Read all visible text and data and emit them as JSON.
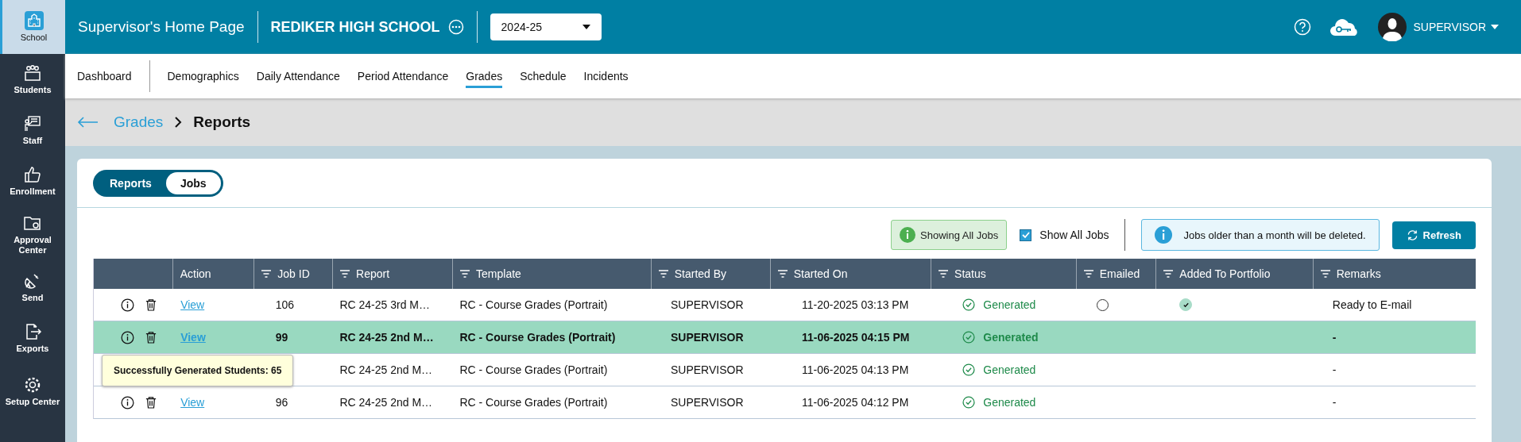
{
  "sidebar": {
    "items": [
      {
        "label": "School",
        "selected": true
      },
      {
        "label": "Students",
        "selected": false
      },
      {
        "label": "Staff",
        "selected": false
      },
      {
        "label": "Enrollment",
        "selected": false
      },
      {
        "label": "Approval Center",
        "selected": false
      },
      {
        "label": "Send",
        "selected": false
      },
      {
        "label": "Exports",
        "selected": false
      },
      {
        "label": "Setup Center",
        "selected": false
      }
    ]
  },
  "header": {
    "title": "Supervisor's Home Page",
    "school": "REDIKER HIGH SCHOOL",
    "year": "2024-25",
    "user": "SUPERVISOR"
  },
  "nav": {
    "items": [
      {
        "label": "Dashboard",
        "selected": false
      },
      {
        "label": "Demographics",
        "selected": false
      },
      {
        "label": "Daily Attendance",
        "selected": false
      },
      {
        "label": "Period Attendance",
        "selected": false
      },
      {
        "label": "Grades",
        "selected": true
      },
      {
        "label": "Schedule",
        "selected": false
      },
      {
        "label": "Incidents",
        "selected": false
      }
    ]
  },
  "breadcrumb": {
    "parent": "Grades",
    "current": "Reports"
  },
  "tabs": [
    {
      "label": "Reports",
      "selected": false
    },
    {
      "label": "Jobs",
      "selected": true
    }
  ],
  "toolbar": {
    "badge": "Showing All Jobs",
    "show_all": {
      "label": "Show All Jobs",
      "checked": true
    },
    "notice": "Jobs older than a month will be deleted.",
    "refresh": "Refresh"
  },
  "table": {
    "columns": [
      "Action",
      "Job ID",
      "Report",
      "Template",
      "Started By",
      "Started On",
      "Status",
      "Emailed",
      "Added To Portfolio",
      "Remarks"
    ],
    "rows": [
      {
        "selected": false,
        "action": "View",
        "job_id": "106",
        "report": "RC 24-25 3rd M…",
        "template": "RC - Course Grades (Portrait)",
        "started_by": "SUPERVISOR",
        "started_on": "11-20-2025 03:13 PM",
        "status": "Generated",
        "emailed": false,
        "portfolio": true,
        "remarks": "Ready to E-mail"
      },
      {
        "selected": true,
        "action": "View",
        "job_id": "99",
        "report": "RC 24-25 2nd M…",
        "template": "RC - Course Grades (Portrait)",
        "started_by": "SUPERVISOR",
        "started_on": "11-06-2025 04:15 PM",
        "status": "Generated",
        "remarks": "-"
      },
      {
        "selected": false,
        "report": "RC 24-25 2nd M…",
        "template": "RC - Course Grades (Portrait)",
        "started_by": "SUPERVISOR",
        "started_on": "11-06-2025 04:13 PM",
        "status": "Generated",
        "remarks": "-"
      },
      {
        "selected": false,
        "action": "View",
        "job_id": "96",
        "report": "RC 24-25 2nd M…",
        "template": "RC - Course Grades (Portrait)",
        "started_by": "SUPERVISOR",
        "started_on": "11-06-2025 04:12 PM",
        "status": "Generated",
        "remarks": "-"
      }
    ],
    "tooltip": "Successfully Generated Students: 65"
  }
}
